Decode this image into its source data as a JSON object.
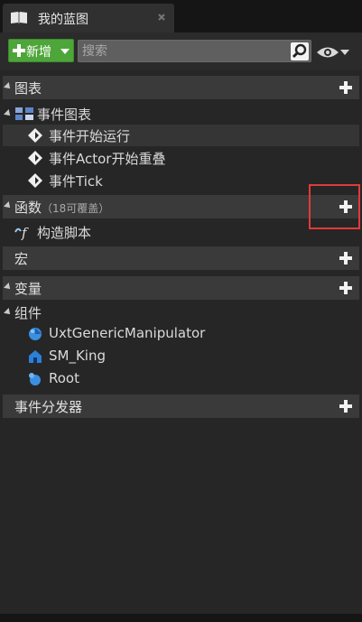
{
  "tab": {
    "title": "我的蓝图",
    "icon": "book-icon"
  },
  "toolbar": {
    "add_label": "新增",
    "search_placeholder": "搜索",
    "search_value": ""
  },
  "sections": {
    "graphs": {
      "label": "图表"
    },
    "event_graph": {
      "label": "事件图表"
    },
    "events": [
      {
        "label": "事件开始运行"
      },
      {
        "label": "事件Actor开始重叠"
      },
      {
        "label": "事件Tick"
      }
    ],
    "functions": {
      "label": "函数",
      "sub": "（18可覆盖）"
    },
    "construction_script": {
      "label": "构造脚本"
    },
    "macros": {
      "label": "宏"
    },
    "variables": {
      "label": "变量"
    },
    "components_group": {
      "label": "组件"
    },
    "components": [
      {
        "label": "UxtGenericManipulator"
      },
      {
        "label": "SM_King"
      },
      {
        "label": "Root"
      }
    ],
    "dispatchers": {
      "label": "事件分发器"
    }
  },
  "colors": {
    "add_button": "#4ea63a",
    "highlight": "#e23a3a"
  }
}
